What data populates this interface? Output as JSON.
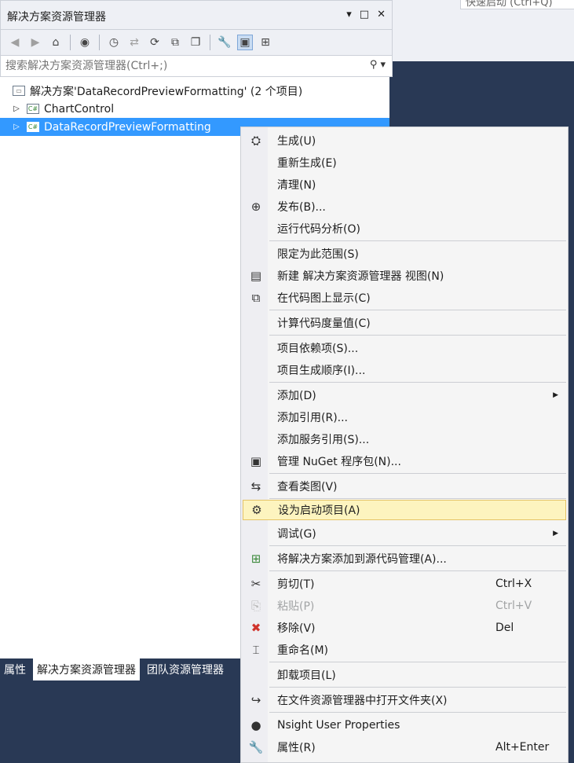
{
  "quick_launch": "快速启动 (Ctrl+Q)",
  "panel": {
    "title": "解决方案资源管理器",
    "title_buttons": [
      "▾",
      "□",
      "✕"
    ],
    "toolbar_icons": [
      "back-icon",
      "forward-icon",
      "home-icon",
      "globe-icon",
      "history-icon",
      "sync-icon",
      "refresh-icon",
      "collapse-all-icon",
      "show-all-files-icon",
      "properties-icon",
      "preview-icon",
      "code-map-icon"
    ],
    "search_placeholder": "搜索解决方案资源管理器(Ctrl+;)"
  },
  "tree": {
    "root": "解决方案'DataRecordPreviewFormatting' (2 个项目)",
    "projects": [
      "ChartControl",
      "DataRecordPreviewFormatting"
    ],
    "project_icon_text": "C#"
  },
  "bottom_tabs": [
    "属性",
    "解决方案资源管理器",
    "团队资源管理器"
  ],
  "menu": {
    "items": [
      {
        "label": "生成(U)",
        "icon": "build-icon",
        "glyph": "⛭"
      },
      {
        "label": "重新生成(E)"
      },
      {
        "label": "清理(N)"
      },
      {
        "label": "发布(B)...",
        "icon": "publish-icon",
        "glyph": "⊕"
      },
      {
        "label": "运行代码分析(O)"
      },
      {
        "label": "限定为此范围(S)"
      },
      {
        "label": "新建 解决方案资源管理器 视图(N)",
        "icon": "new-view-icon",
        "glyph": "▤"
      },
      {
        "label": "在代码图上显示(C)",
        "icon": "code-map-icon",
        "glyph": "⧉"
      },
      {
        "label": "计算代码度量值(C)"
      },
      {
        "label": "项目依赖项(S)..."
      },
      {
        "label": "项目生成顺序(I)..."
      },
      {
        "label": "添加(D)",
        "submenu": "▶"
      },
      {
        "label": "添加引用(R)..."
      },
      {
        "label": "添加服务引用(S)..."
      },
      {
        "label": "管理 NuGet 程序包(N)...",
        "icon": "nuget-icon",
        "glyph": "▣"
      },
      {
        "label": "查看类图(V)",
        "icon": "class-diagram-icon",
        "glyph": "⇆"
      },
      {
        "label": "设为启动项目(A)",
        "icon": "gear-icon",
        "glyph": "⚙",
        "highlight": true
      },
      {
        "label": "调试(G)",
        "submenu": "▶"
      },
      {
        "label": "将解决方案添加到源代码管理(A)...",
        "icon": "source-control-icon",
        "glyph": "⊞"
      },
      {
        "label": "剪切(T)",
        "icon": "scissors-icon",
        "glyph": "✂",
        "shortcut": "Ctrl+X"
      },
      {
        "label": "粘贴(P)",
        "icon": "paste-icon",
        "glyph": "⎘",
        "shortcut": "Ctrl+V",
        "disabled": true
      },
      {
        "label": "移除(V)",
        "icon": "delete-icon",
        "glyph": "✖",
        "shortcut": "Del"
      },
      {
        "label": "重命名(M)",
        "icon": "rename-icon",
        "glyph": "⌶"
      },
      {
        "label": "卸载项目(L)"
      },
      {
        "label": "在文件资源管理器中打开文件夹(X)",
        "icon": "open-folder-icon",
        "glyph": "↪"
      },
      {
        "label": "Nsight User Properties",
        "icon": "nsight-icon",
        "glyph": "●"
      },
      {
        "label": "属性(R)",
        "icon": "wrench-icon",
        "glyph": "🔧",
        "shortcut": "Alt+Enter"
      }
    ]
  },
  "colors": {
    "background": "#293955",
    "selection": "#3399ff",
    "menu_highlight": "#fdf4bf"
  }
}
